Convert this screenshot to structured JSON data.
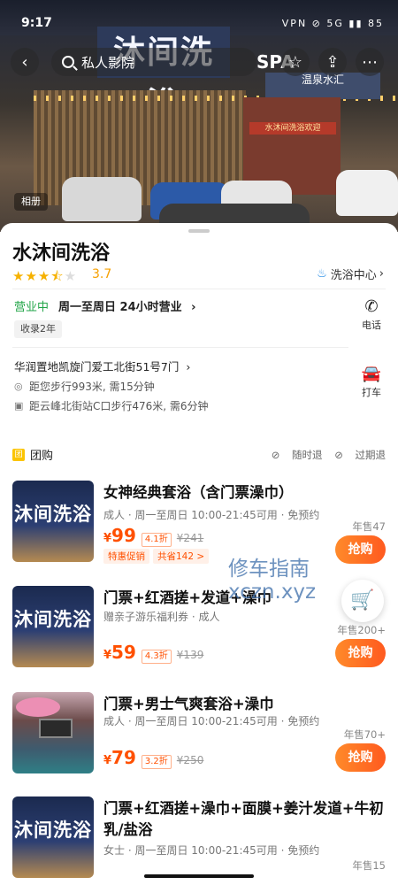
{
  "status_bar": {
    "time": "9:17",
    "indicators": "VPN ⊘ 5G ▮▮ 85"
  },
  "nav": {
    "back_icon": "chevron-left",
    "search_placeholder": "私人影院",
    "favorite_icon": "star-outline",
    "share_icon": "share",
    "more_icon": "ellipsis"
  },
  "hero": {
    "album_label": "相册",
    "sign_text": "沐间洗浴",
    "spa_text": "SPA",
    "shop_sign": "温泉水汇",
    "door_sign": "水沐间洗浴欢迎"
  },
  "store": {
    "name": "水沐间洗浴",
    "rating": 3.7,
    "rating_text": "3.7",
    "category": "洗浴中心",
    "open_status": "营业中",
    "hours": "周一至周日 24小时营业",
    "listed_tag": "收录2年",
    "phone_label": "电话",
    "taxi_label": "打车",
    "address": "华润置地凯旋门爱工北街51号7门",
    "walk_distance": "距您步行993米, 需15分钟",
    "metro_distance": "距云峰北街站C口步行476米, 需6分钟"
  },
  "group_buy": {
    "title": "团购",
    "badge": "团",
    "tag_refund_anytime": "随时退",
    "tag_refund_expired": "过期退",
    "deals": [
      {
        "title": "女神经典套浴（含门票澡巾）",
        "meta": "成人 · 周一至周日 10:00-21:45可用 · 免预约",
        "price": "99",
        "discount": "4.1折",
        "original": "¥241",
        "promo": [
          "特惠促销",
          "共省142 >"
        ],
        "sold": "年售47",
        "buy_label": "抢购"
      },
      {
        "title": "门票+红酒搓+发道+澡巾",
        "meta": "赠亲子游乐福利券 · 成人",
        "price": "59",
        "discount": "4.3折",
        "original": "¥139",
        "sold": "年售200+",
        "buy_label": "抢购"
      },
      {
        "title": "门票+男士气爽套浴+澡巾",
        "meta": "成人 · 周一至周日 10:00-21:45可用 · 免预约",
        "price": "79",
        "discount": "3.2折",
        "original": "¥250",
        "sold": "年售70+",
        "buy_label": "抢购"
      },
      {
        "title": "门票+红酒搓+澡巾+面膜+姜汁发道+牛初乳/盐浴",
        "meta": "女士 · 周一至周日 10:00-21:45可用 · 免预约",
        "sold": "年售15"
      }
    ],
    "thumb_text": "沐间洗浴"
  },
  "currency": "¥",
  "watermark": {
    "line1": "修车指南",
    "line2": "xczn.xyz"
  },
  "colors": {
    "accent": "#ff5000",
    "open_green": "#22a548",
    "star": "#f6b100"
  }
}
